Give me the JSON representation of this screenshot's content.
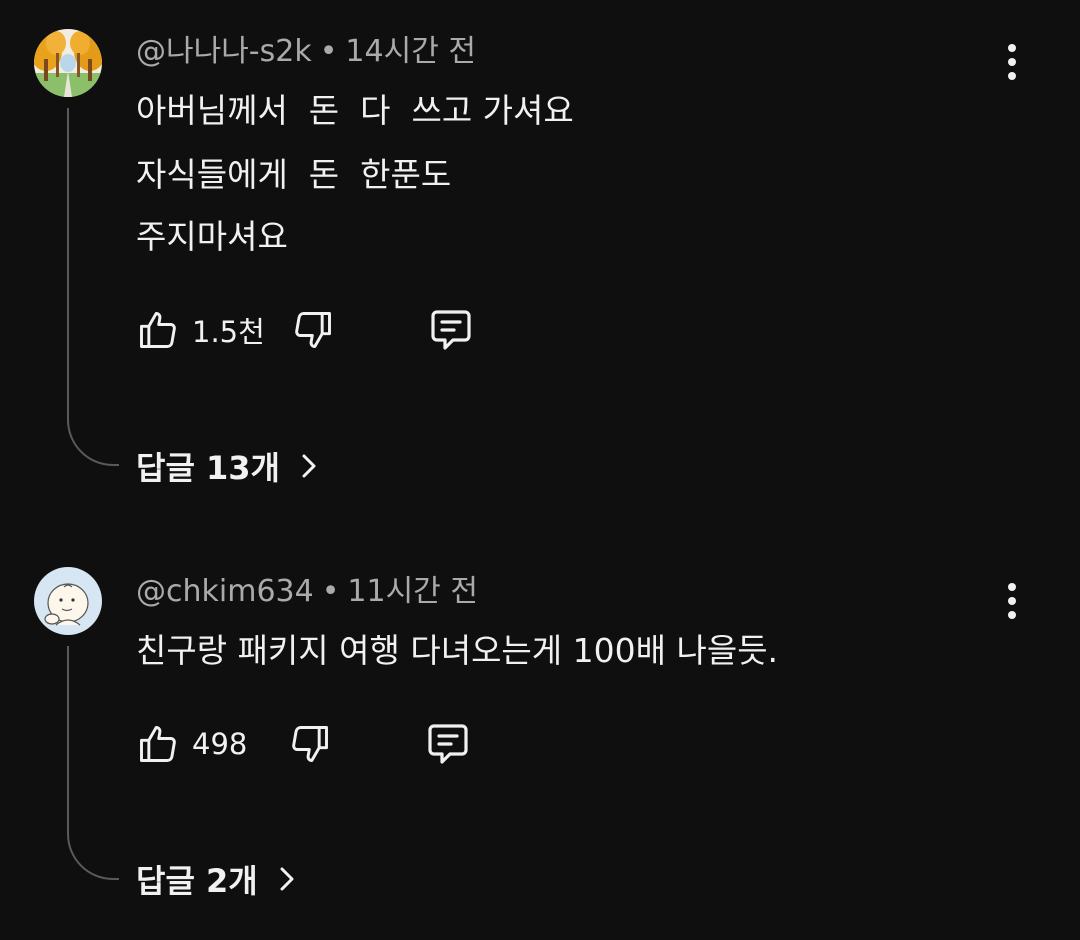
{
  "comments": [
    {
      "author": "@나나나-s2k",
      "separator": "•",
      "time": "14시간 전",
      "lines": [
        "아버님께서  돈  다  쓰고 가셔요",
        "자식들에게  돈  한푼도",
        "주지마셔요"
      ],
      "likes": "1.5천",
      "replies_label": "답글 13개",
      "avatar_icon": "autumn-trees-icon"
    },
    {
      "author": "@chkim634",
      "separator": "•",
      "time": "11시간 전",
      "lines": [
        "친구랑 패키지 여행 다녀오는게 100배 나을듯."
      ],
      "likes": "498",
      "replies_label": "답글 2개",
      "avatar_icon": "cartoon-character-icon"
    }
  ],
  "colors": {
    "background": "#0f0f0f",
    "text": "#f1f1f1",
    "meta": "#aaaaaa",
    "thread_line": "#5a5a5a"
  }
}
